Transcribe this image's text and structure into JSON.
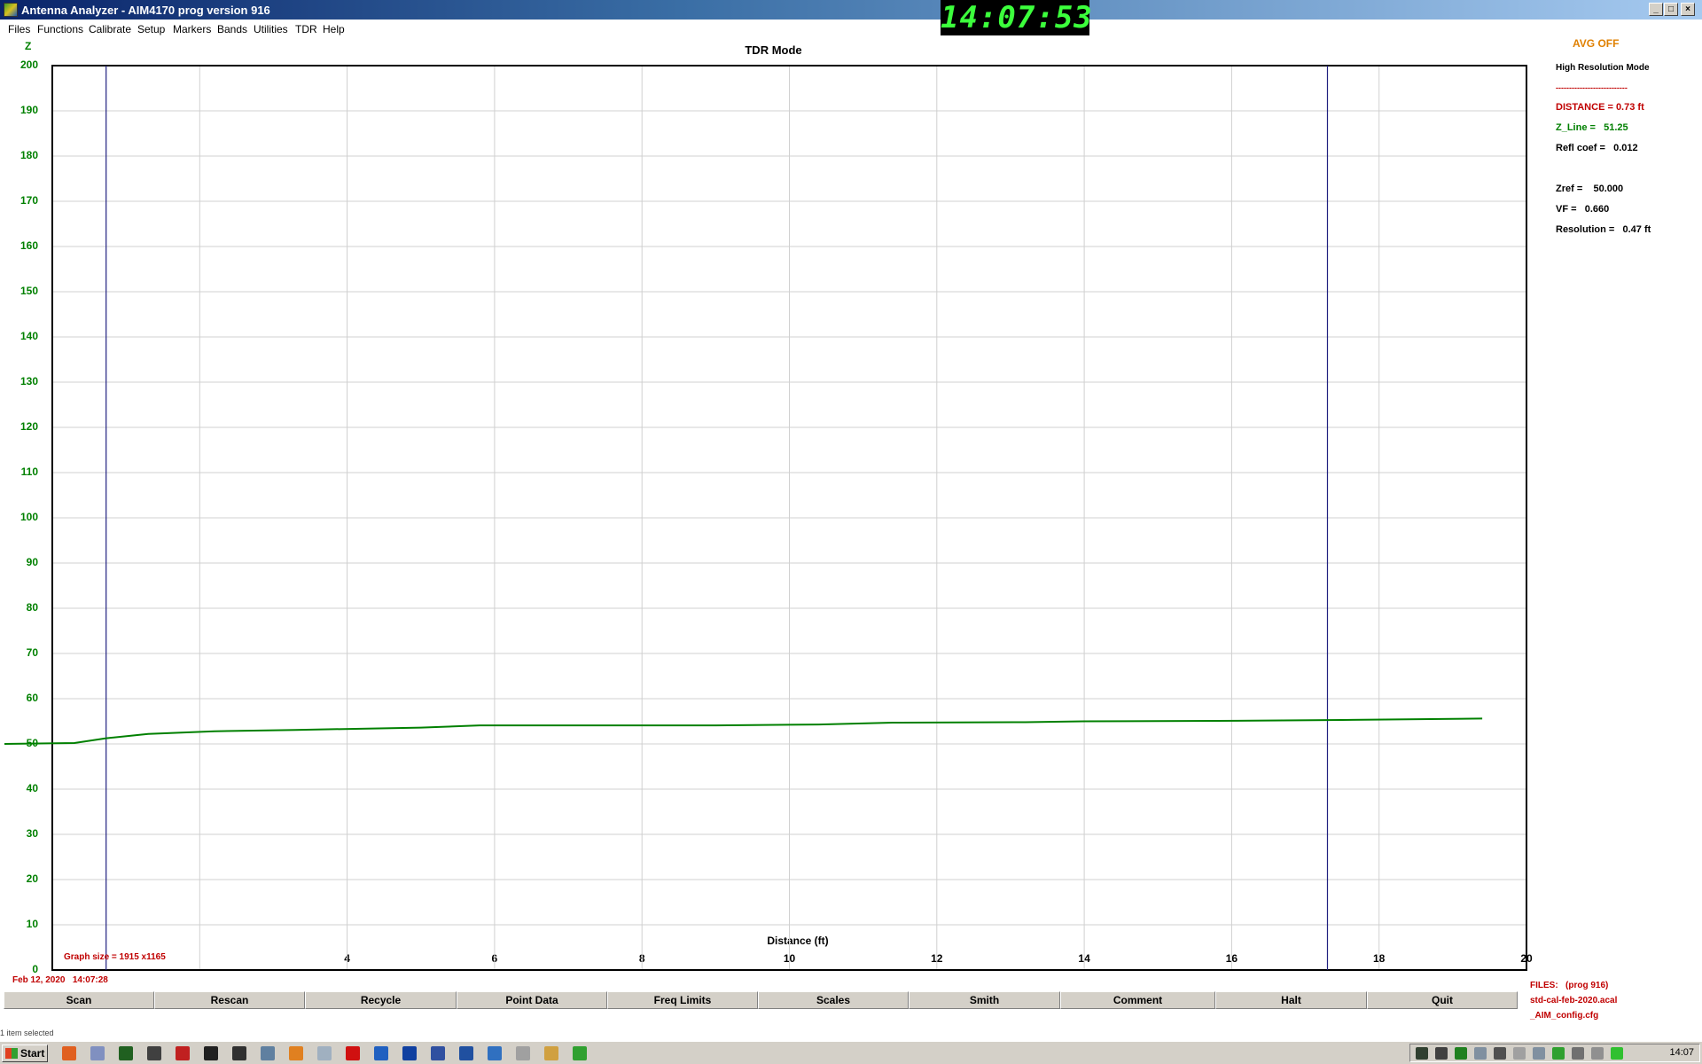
{
  "window": {
    "title": "Antenna Analyzer -  AIM4170    prog version 916",
    "clock": "14:07:53",
    "controls": [
      "_",
      "□",
      "×"
    ]
  },
  "menu": [
    "Files",
    "Functions",
    "Calibrate",
    "Setup",
    "Markers",
    "Bands",
    "Utilities",
    "TDR",
    "Help"
  ],
  "graph": {
    "title": "TDR Mode",
    "graph_size": "Graph size = 1915 x1165",
    "timestamp": "Feb 12, 2020   14:07:28"
  },
  "chart_data": {
    "type": "line",
    "title": "TDR Mode",
    "xlabel": "Distance (ft)",
    "ylabel": "Z",
    "xlim": [
      0,
      20
    ],
    "ylim": [
      0,
      200
    ],
    "xticks": [
      "4",
      "6",
      "8",
      "10",
      "12",
      "14",
      "16",
      "18",
      "20"
    ],
    "yticks": [
      "0",
      "10",
      "20",
      "30",
      "40",
      "50",
      "60",
      "70",
      "80",
      "90",
      "100",
      "110",
      "120",
      "130",
      "140",
      "150",
      "160",
      "170",
      "180",
      "190",
      "200"
    ],
    "grid": true,
    "series": [
      {
        "color": "#008000",
        "x": [
          -0.65,
          0.3,
          0.73,
          1.3,
          2.2,
          3.3,
          5.0,
          5.8,
          7.0,
          9.0,
          10.4,
          11.4,
          13.2,
          14.0,
          15.8,
          17.5,
          19.4
        ],
        "y": [
          50.0,
          50.2,
          51.25,
          52.2,
          52.8,
          53.1,
          53.6,
          54.1,
          54.1,
          54.1,
          54.3,
          54.7,
          54.8,
          55.0,
          55.1,
          55.3,
          55.6
        ]
      }
    ],
    "markers": [
      {
        "x": 0.73,
        "color": "#202080"
      },
      {
        "x": 17.3,
        "color": "#202080"
      }
    ]
  },
  "info": {
    "avg": "AVG OFF",
    "mode": "High Resolution Mode",
    "separator": "---------------------------",
    "distance": "DISTANCE = 0.73 ft",
    "z_line": "Z_Line =   51.25",
    "refl_coef": "Refl coef =   0.012",
    "zref": "Zref =    50.000",
    "vf": "VF =   0.660",
    "resolution": "Resolution =   0.47 ft"
  },
  "files": {
    "header": "FILES:   (prog 916)",
    "cal": "std-cal-feb-2020.acal",
    "cfg": "_AIM_config.cfg"
  },
  "buttons": [
    "Scan",
    "Rescan",
    "Recycle",
    "Point Data",
    "Freq Limits",
    "Scales",
    "Smith",
    "Comment",
    "Halt",
    "Quit"
  ],
  "status_bar": "1 item selected",
  "taskbar": {
    "start": "Start",
    "time": "14:07",
    "app_icons": [
      "firefox-icon",
      "window-icon",
      "grid-icon",
      "settings-icon",
      "bug-icon",
      "pacman-icon",
      "terminal-icon",
      "network-icon",
      "sync-icon",
      "document-icon",
      "opera-icon",
      "v2-icon",
      "word-icon",
      "equalizer-icon",
      "globe-icon",
      "globe2-icon",
      "file-icon",
      "folder-icon",
      "antenna-analyzer-icon"
    ],
    "tray_icons": [
      "app-tray-icon",
      "v-tray-icon",
      "shield-icon",
      "speedometer-icon",
      "hand-icon",
      "flag-icon",
      "network-tray-icon",
      "check-icon",
      "volume-icon",
      "audio-icon",
      "green-circle-icon"
    ]
  }
}
